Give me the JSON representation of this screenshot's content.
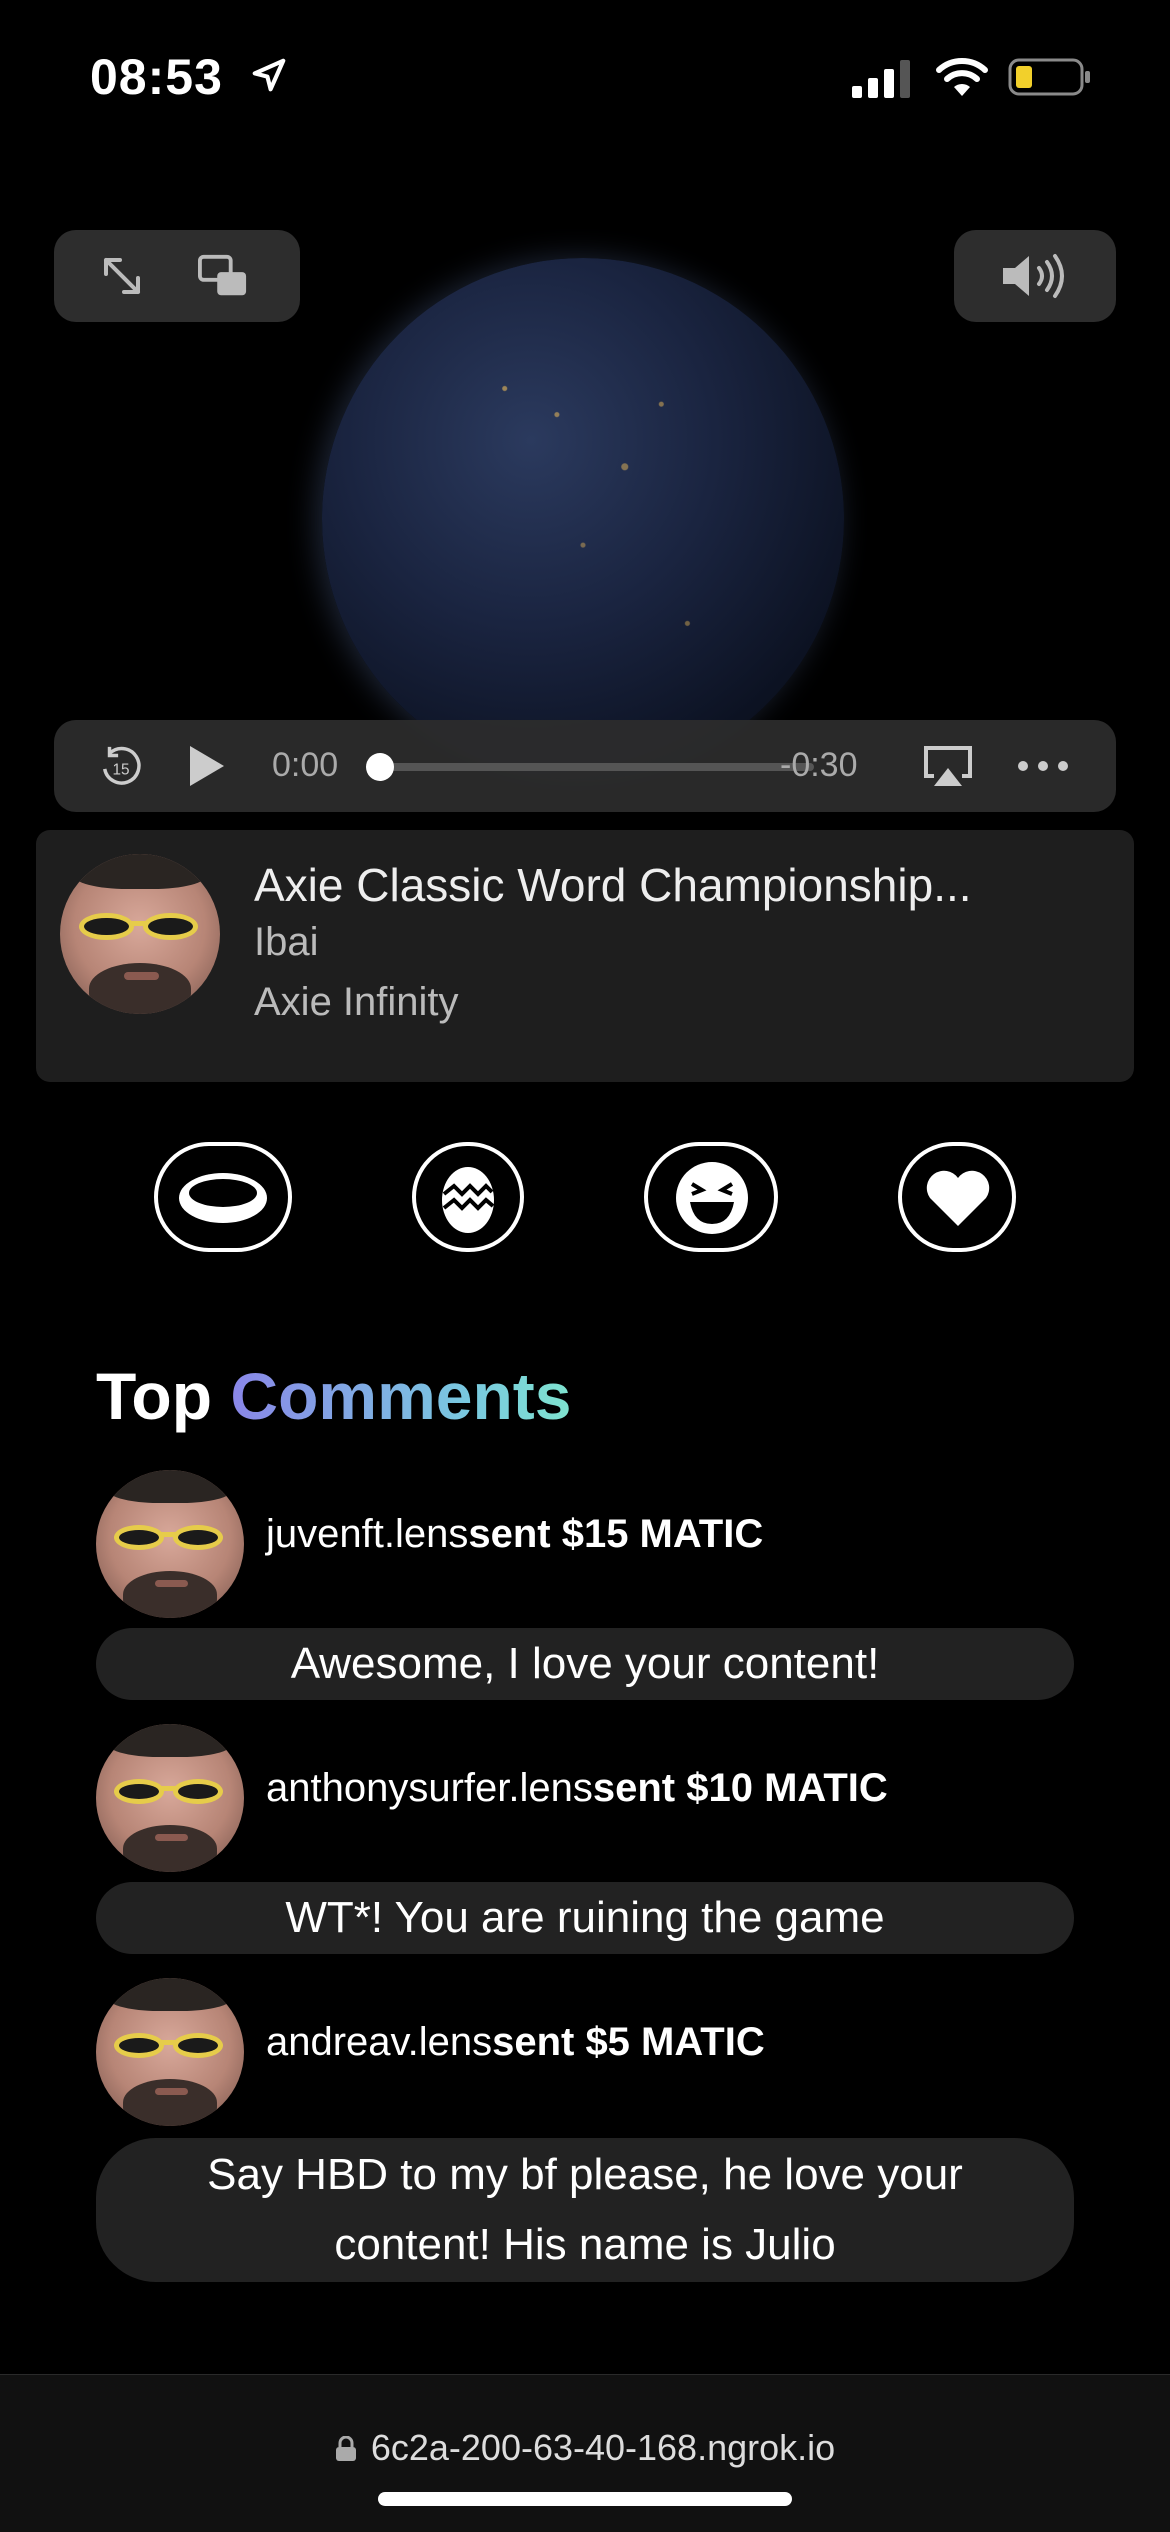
{
  "status_bar": {
    "time": "08:53"
  },
  "video": {
    "current_time": "0:00",
    "remaining_time": "-0:30",
    "progress": 0,
    "skip_back_seconds": "15"
  },
  "stream": {
    "title": "Axie Classic Word Championship...",
    "streamer": "Ibai",
    "game": "Axie Infinity"
  },
  "reactions": [
    "ring-icon",
    "egg-icon",
    "laugh-icon",
    "heart-icon"
  ],
  "comments_section": {
    "title_plain": "Top",
    "title_gradient": "Comments"
  },
  "comments": [
    {
      "user": "juvenft.lens",
      "amount": "sent $15 MATIC",
      "message": "Awesome, I love your content!"
    },
    {
      "user": "anthonysurfer.lens",
      "amount": "sent $10 MATIC",
      "message": "WT*! You are ruining the game"
    },
    {
      "user": "andreav.lens",
      "amount": "sent $5 MATIC",
      "message": "Say HBD to my bf please, he love your content! His name is Julio"
    }
  ],
  "browser": {
    "url": "6c2a-200-63-40-168.ngrok.io"
  },
  "colors": {
    "background": "#000000",
    "gradient_start": "#8a86e8",
    "gradient_end": "#7fe3cf",
    "battery": "#f2d02b"
  }
}
